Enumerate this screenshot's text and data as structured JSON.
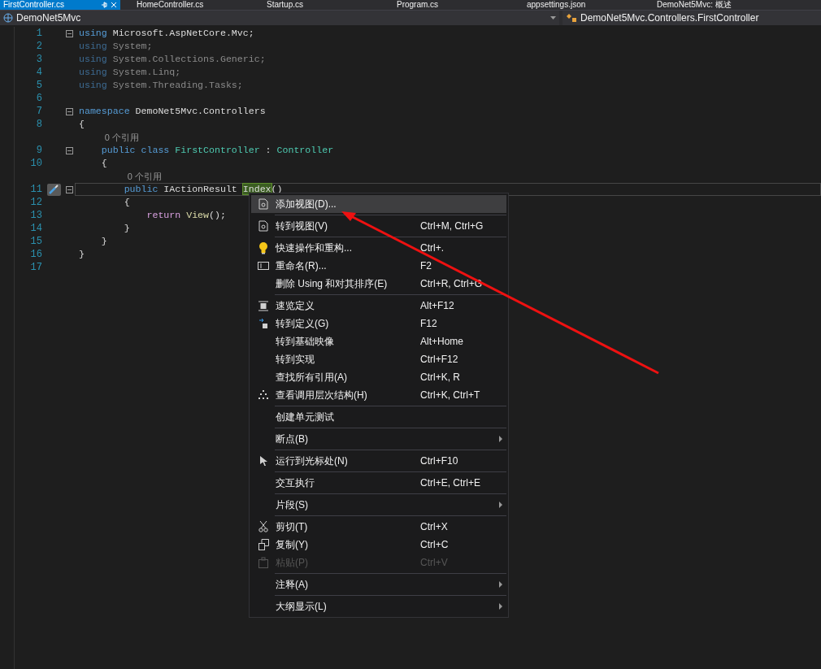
{
  "tabs": [
    {
      "label": "FirstController.cs",
      "selected": true
    },
    {
      "label": "HomeController.cs",
      "selected": false
    },
    {
      "label": "Startup.cs",
      "selected": false
    },
    {
      "label": "Program.cs",
      "selected": false
    },
    {
      "label": "appsettings.json",
      "selected": false
    },
    {
      "label": "DemoNet5Mvc: 概述",
      "selected": false
    }
  ],
  "nav_bar": {
    "project": "DemoNet5Mvc",
    "member": "DemoNet5Mvc.Controllers.FirstController"
  },
  "code_lines": [
    {
      "number": "1",
      "fold": true,
      "current": false,
      "quick_action": false,
      "tokens": [
        {
          "text": "using",
          "kind": "keyword"
        },
        {
          "text": " Microsoft.AspNetCore.Mvc;",
          "kind": "plain"
        }
      ]
    },
    {
      "number": "2",
      "fold": false,
      "current": false,
      "quick_action": false,
      "tokens": [
        {
          "text": "using",
          "kind": "unused_keyword"
        },
        {
          "text": " System;",
          "kind": "unused"
        }
      ]
    },
    {
      "number": "3",
      "fold": false,
      "current": false,
      "quick_action": false,
      "tokens": [
        {
          "text": "using",
          "kind": "unused_keyword"
        },
        {
          "text": " System.Collections.Generic;",
          "kind": "unused"
        }
      ]
    },
    {
      "number": "4",
      "fold": false,
      "current": false,
      "quick_action": false,
      "tokens": [
        {
          "text": "using",
          "kind": "unused_keyword"
        },
        {
          "text": " System.Linq;",
          "kind": "unused"
        }
      ]
    },
    {
      "number": "5",
      "fold": false,
      "current": false,
      "quick_action": false,
      "tokens": [
        {
          "text": "using",
          "kind": "unused_keyword"
        },
        {
          "text": " System.Threading.Tasks;",
          "kind": "unused"
        }
      ]
    },
    {
      "number": "6",
      "fold": false,
      "current": false,
      "quick_action": false
    },
    {
      "number": "7",
      "fold": true,
      "current": false,
      "quick_action": false,
      "tokens": [
        {
          "text": "namespace",
          "kind": "keyword"
        },
        {
          "text": " DemoNet5Mvc.Controllers",
          "kind": "plain"
        }
      ]
    },
    {
      "number": "8",
      "fold": false,
      "current": false,
      "quick_action": false,
      "tokens": [
        {
          "text": "{",
          "kind": "plain"
        }
      ]
    },
    {
      "number": "9",
      "fold": true,
      "current": false,
      "quick_action": false,
      "codelens": "0 个引用",
      "tokens": [
        {
          "text": "    public class",
          "kind": "keyword"
        },
        {
          "text": " FirstController",
          "kind": "type"
        },
        {
          "text": " : ",
          "kind": "plain"
        },
        {
          "text": "Controller",
          "kind": "type"
        }
      ]
    },
    {
      "number": "10",
      "fold": false,
      "current": false,
      "quick_action": false,
      "tokens": [
        {
          "text": "    {",
          "kind": "plain"
        }
      ]
    },
    {
      "number": "11",
      "fold": true,
      "current": true,
      "quick_action": true,
      "codelens": "0 个引用",
      "tokens": [
        {
          "text": "        public",
          "kind": "keyword"
        },
        {
          "text": " IActionResult ",
          "kind": "plain"
        },
        {
          "text": "Index",
          "kind": "highlight"
        },
        {
          "text": "()",
          "kind": "plain"
        }
      ]
    },
    {
      "number": "12",
      "fold": false,
      "current": false,
      "quick_action": false,
      "tokens": [
        {
          "text": "        {",
          "kind": "plain"
        }
      ]
    },
    {
      "number": "13",
      "fold": false,
      "current": false,
      "quick_action": false,
      "tokens": [
        {
          "text": "            return",
          "kind": "control"
        },
        {
          "text": " View",
          "kind": "method"
        },
        {
          "text": "();",
          "kind": "plain"
        }
      ]
    },
    {
      "number": "14",
      "fold": false,
      "current": false,
      "quick_action": false,
      "tokens": [
        {
          "text": "        }",
          "kind": "plain"
        }
      ]
    },
    {
      "number": "15",
      "fold": false,
      "current": false,
      "quick_action": false,
      "tokens": [
        {
          "text": "    }",
          "kind": "plain"
        }
      ]
    },
    {
      "number": "16",
      "fold": false,
      "current": false,
      "quick_action": false,
      "tokens": [
        {
          "text": "}",
          "kind": "plain"
        }
      ]
    },
    {
      "number": "17",
      "fold": false,
      "current": false,
      "quick_action": false
    }
  ],
  "context_menu": [
    {
      "kind": "item",
      "label": "添加视图(D)...",
      "selected": true,
      "disabled": false,
      "submenu": false
    },
    {
      "kind": "separator"
    },
    {
      "kind": "item",
      "label": "转到视图(V)",
      "shortcut": "Ctrl+M, Ctrl+G",
      "selected": false,
      "disabled": false,
      "submenu": false
    },
    {
      "kind": "separator"
    },
    {
      "kind": "item",
      "label": "快速操作和重构...",
      "shortcut": "Ctrl+.",
      "selected": false,
      "disabled": false,
      "submenu": false
    },
    {
      "kind": "item",
      "label": "重命名(R)...",
      "shortcut": "F2",
      "selected": false,
      "disabled": false,
      "submenu": false
    },
    {
      "kind": "item",
      "label": "删除 Using 和对其排序(E)",
      "shortcut": "Ctrl+R, Ctrl+G",
      "selected": false,
      "disabled": false,
      "submenu": false
    },
    {
      "kind": "separator"
    },
    {
      "kind": "item",
      "label": "速览定义",
      "shortcut": "Alt+F12",
      "selected": false,
      "disabled": false,
      "submenu": false
    },
    {
      "kind": "item",
      "label": "转到定义(G)",
      "shortcut": "F12",
      "selected": false,
      "disabled": false,
      "submenu": false
    },
    {
      "kind": "item",
      "label": "转到基础映像",
      "shortcut": "Alt+Home",
      "selected": false,
      "disabled": false,
      "submenu": false
    },
    {
      "kind": "item",
      "label": "转到实现",
      "shortcut": "Ctrl+F12",
      "selected": false,
      "disabled": false,
      "submenu": false
    },
    {
      "kind": "item",
      "label": "查找所有引用(A)",
      "shortcut": "Ctrl+K, R",
      "selected": false,
      "disabled": false,
      "submenu": false
    },
    {
      "kind": "item",
      "label": "查看调用层次结构(H)",
      "shortcut": "Ctrl+K, Ctrl+T",
      "selected": false,
      "disabled": false,
      "submenu": false
    },
    {
      "kind": "separator"
    },
    {
      "kind": "item",
      "label": "创建单元测试",
      "selected": false,
      "disabled": false,
      "submenu": false
    },
    {
      "kind": "separator"
    },
    {
      "kind": "item",
      "label": "断点(B)",
      "selected": false,
      "disabled": false,
      "submenu": true
    },
    {
      "kind": "separator"
    },
    {
      "kind": "item",
      "label": "运行到光标处(N)",
      "shortcut": "Ctrl+F10",
      "selected": false,
      "disabled": false,
      "submenu": false
    },
    {
      "kind": "separator"
    },
    {
      "kind": "item",
      "label": "交互执行",
      "shortcut": "Ctrl+E, Ctrl+E",
      "selected": false,
      "disabled": false,
      "submenu": false
    },
    {
      "kind": "separator"
    },
    {
      "kind": "item",
      "label": "片段(S)",
      "selected": false,
      "disabled": false,
      "submenu": true
    },
    {
      "kind": "separator"
    },
    {
      "kind": "item",
      "label": "剪切(T)",
      "shortcut": "Ctrl+X",
      "selected": false,
      "disabled": false,
      "submenu": false
    },
    {
      "kind": "item",
      "label": "复制(Y)",
      "shortcut": "Ctrl+C",
      "selected": false,
      "disabled": false,
      "submenu": false
    },
    {
      "kind": "item",
      "label": "粘贴(P)",
      "shortcut": "Ctrl+V",
      "selected": false,
      "disabled": true,
      "submenu": false
    },
    {
      "kind": "separator"
    },
    {
      "kind": "item",
      "label": "注释(A)",
      "selected": false,
      "disabled": false,
      "submenu": true
    },
    {
      "kind": "separator"
    },
    {
      "kind": "item",
      "label": "大纲显示(L)",
      "selected": false,
      "disabled": false,
      "submenu": true
    }
  ]
}
